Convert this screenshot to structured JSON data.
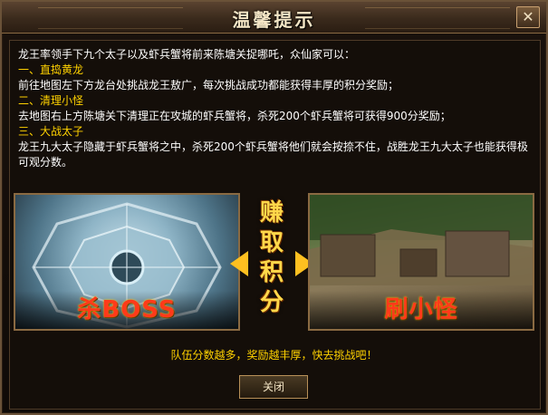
{
  "dialog": {
    "title": "温馨提示",
    "close_icon": "close-icon"
  },
  "intro": "龙王率领手下九个太子以及虾兵蟹将前来陈塘关捉哪吒，众仙家可以：",
  "sections": [
    {
      "heading": "一、直捣黄龙",
      "text": "前往地图左下方龙台处挑战龙王敖广，每次挑战成功都能获得丰厚的积分奖励；"
    },
    {
      "heading": "二、清理小怪",
      "text": "去地图右上方陈塘关下清理正在攻城的虾兵蟹将，杀死200个虾兵蟹将可获得900分奖励；"
    },
    {
      "heading": "三、大战太子",
      "text": "龙王九大太子隐藏于虾兵蟹将之中，杀死200个虾兵蟹将他们就会按捺不住，战胜龙王九大太子也能获得极可观分数。"
    }
  ],
  "panels": {
    "left_caption": "杀BOSS",
    "right_caption": "刷小怪",
    "center_chars": [
      "赚",
      "取",
      "积",
      "分"
    ]
  },
  "footer_text": "队伍分数越多，奖励越丰厚，快去挑战吧！",
  "close_button_label": "关闭",
  "colors": {
    "highlight": "#ffd200",
    "body_text": "#ffffff",
    "caption_red": "#ff3a1a"
  }
}
